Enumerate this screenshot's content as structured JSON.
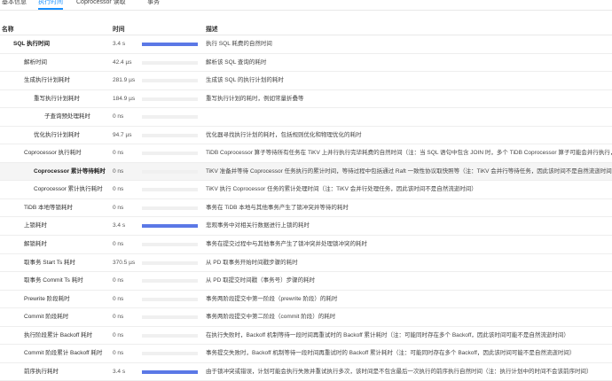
{
  "tabs": [
    {
      "label": "基本信息",
      "active": false
    },
    {
      "label": "执行时间",
      "active": true
    },
    {
      "label": "Coprocessor 读取",
      "active": false
    },
    {
      "label": "事务",
      "active": false
    }
  ],
  "columns": {
    "name": "名称",
    "time": "时间",
    "desc": "描述"
  },
  "colors": {
    "accent": "#1890ff",
    "bar_fill": "#5b78e6",
    "bar_track": "#f0f0f0",
    "row_highlight": "#f5f5f5"
  },
  "rows": [
    {
      "name": "SQL 执行时间",
      "level": 0,
      "bold": true,
      "time": "3.4 s",
      "bar": 1.0,
      "desc": "执行 SQL 耗费的自然时间"
    },
    {
      "name": "解析时间",
      "level": 1,
      "time": "42.4 µs",
      "bar": 0,
      "desc": "解析该 SQL 查询的耗时"
    },
    {
      "name": "生成执行计划耗时",
      "level": 1,
      "time": "281.9 µs",
      "bar": 0,
      "desc": "生成该 SQL 的执行计划的耗时"
    },
    {
      "name": "重写执行计划耗时",
      "level": 2,
      "time": "184.9 µs",
      "bar": 0,
      "desc": "重写执行计划的耗时，例如常量折叠等"
    },
    {
      "name": "子查询预处理耗时",
      "level": 3,
      "time": "0 ns",
      "bar": 0,
      "desc": ""
    },
    {
      "name": "优化执行计划耗时",
      "level": 2,
      "time": "94.7 µs",
      "bar": 0,
      "desc": "优化器寻找执行计划的耗时，包括规则优化和物理优化的耗时"
    },
    {
      "name": "Coprocessor 执行耗时",
      "level": 1,
      "time": "0 ns",
      "bar": 0,
      "desc": "TiDB Coprocessor 算子等待所有任务在 TiKV 上并行执行完毕耗费的自然时间（注：当 SQL 语句中包含 JOIN 时，多个 TiDB Coprocessor 算子可能会并行执行，此时不再等"
    },
    {
      "name": "Coprocessor 累计等待耗时",
      "level": 2,
      "bold": true,
      "highlight": true,
      "time": "0 ns",
      "bar": 0,
      "desc": "TiKV 准备并等待 Coprocessor 任务执行的累计时间，等待过程中包括通过 Raft 一致性协议取快照等（注：TiKV 会并行等待任务，因此该时间不是自然流逝时间）"
    },
    {
      "name": "Coprocessor 累计执行耗时",
      "level": 2,
      "time": "0 ns",
      "bar": 0,
      "desc": "TiKV 执行 Coprocessor 任务的累计处理时间（注：TiKV 会并行处理任务，因此该时间不是自然流逝时间）"
    },
    {
      "name": "TiDB 本地等锁耗时",
      "level": 1,
      "time": "0 ns",
      "bar": 0,
      "desc": "事务在 TiDB 本地与其他事务产生了锁冲突并等待的耗时"
    },
    {
      "name": "上锁耗时",
      "level": 1,
      "time": "3.4 s",
      "bar": 1.0,
      "desc": "悲观事务中对相关行数据进行上锁的耗时"
    },
    {
      "name": "解锁耗时",
      "level": 1,
      "time": "0 ns",
      "bar": 0,
      "desc": "事务在提交过程中与其他事务产生了锁冲突并处理锁冲突的耗时"
    },
    {
      "name": "取事务 Start Ts 耗时",
      "level": 1,
      "time": "370.5 µs",
      "bar": 0,
      "desc": "从 PD 取事务开始时间戳步骤的耗时"
    },
    {
      "name": "取事务 Commit Ts 耗时",
      "level": 1,
      "time": "0 ns",
      "bar": 0,
      "desc": "从 PD 取提交时间戳（事务号）步骤的耗时"
    },
    {
      "name": "Prewrite 阶段耗时",
      "level": 1,
      "time": "0 ns",
      "bar": 0,
      "desc": "事务两阶段提交中第一阶段（prewrite 阶段）的耗时"
    },
    {
      "name": "Commit 阶段耗时",
      "level": 1,
      "time": "0 ns",
      "bar": 0,
      "desc": "事务两阶段提交中第二阶段（commit 阶段）的耗时"
    },
    {
      "name": "执行阶段累计 Backoff 耗时",
      "level": 1,
      "time": "0 ns",
      "bar": 0,
      "desc": "在执行失败时，Backoff 机制等待一段时间再重试时的 Backoff 累计耗时（注：可能同时存在多个 Backoff，因此该时间可能不是自然流逝时间）"
    },
    {
      "name": "Commit 阶段累计 Backoff 耗时",
      "level": 1,
      "time": "0 ns",
      "bar": 0,
      "desc": "事务提交失败时，Backoff 机制等待一段时间再重试时的 Backoff 累计耗时（注：可能同时存在多个 Backoff，因此该时间可能不是自然流逝时间）"
    },
    {
      "name": "前序执行耗时",
      "level": 1,
      "time": "3.4 s",
      "bar": 1.0,
      "desc": "由于锁冲突或错误，计划可能会执行失败并重试执行多次，该时间是不包含最后一次执行的前序执行自然时间（注：执行计划中的时间不会该前序时间）"
    }
  ]
}
